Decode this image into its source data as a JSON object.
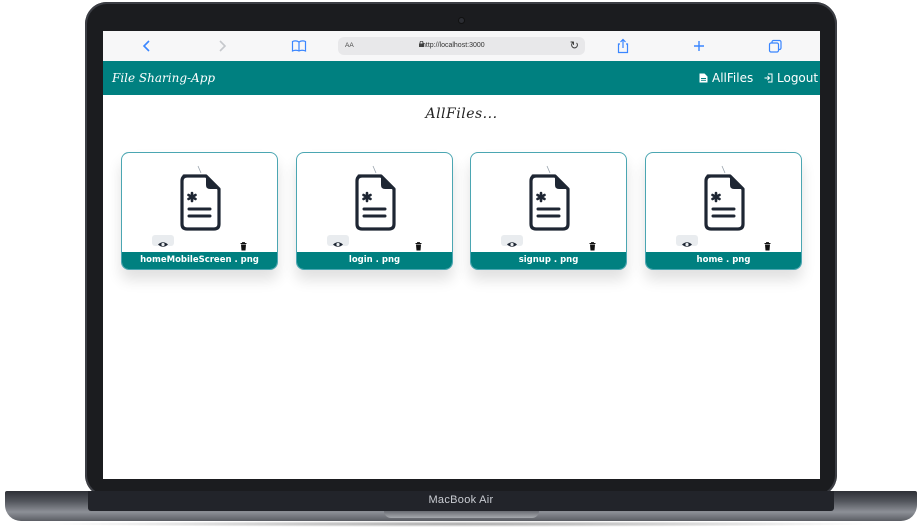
{
  "device": {
    "label": "MacBook Air"
  },
  "browser": {
    "text_size_label": "AA",
    "url": "http://localhost:3000"
  },
  "navbar": {
    "brand": "File Sharing-App",
    "links": [
      {
        "label": "AllFiles",
        "icon": "file-icon"
      },
      {
        "label": "Logout",
        "icon": "logout-icon"
      }
    ]
  },
  "page": {
    "title": "AllFiles..."
  },
  "files": [
    {
      "name": "homeMobileScreen . png"
    },
    {
      "name": "login . png"
    },
    {
      "name": "signup . png"
    },
    {
      "name": "home . png"
    }
  ],
  "colors": {
    "accent": "#008080",
    "card_border": "#4ba6b2",
    "icon_dark": "#1e2633"
  }
}
